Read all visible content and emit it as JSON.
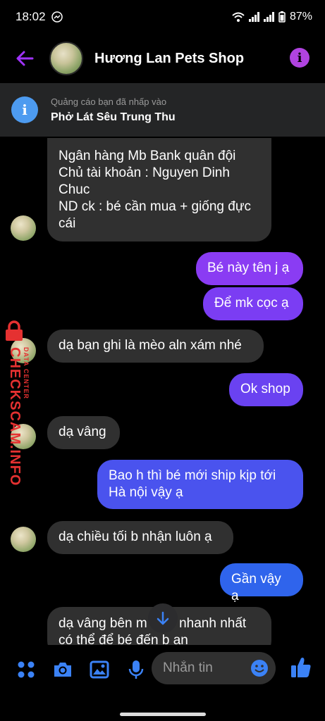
{
  "status": {
    "time": "18:02",
    "battery": "87%"
  },
  "header": {
    "title": "Hương Lan Pets Shop"
  },
  "ad": {
    "subtitle": "Quảng cáo bạn đã nhấp vào",
    "title": "Phở Lát Sêu Trung Thu"
  },
  "messages": [
    {
      "dir": "in",
      "text": "Ngân hàng Mb Bank quân đội\nChủ tài khoản : Nguyen Dinh Chuc\nND ck : bé cần mua + giống đực cái"
    },
    {
      "dir": "out",
      "text": "Bé này tên j ạ"
    },
    {
      "dir": "out",
      "text": "Để mk cọc ạ"
    },
    {
      "dir": "in",
      "text": "dạ bạn ghi là mèo aln xám nhé"
    },
    {
      "dir": "out",
      "text": "Ok shop"
    },
    {
      "dir": "in",
      "text": "dạ vâng"
    },
    {
      "dir": "out",
      "text": "Bao h thì bé mới ship kịp tới Hà nội vậy ạ"
    },
    {
      "dir": "in",
      "text": "dạ chiều tối b nhận luôn ạ"
    },
    {
      "dir": "out",
      "text": "Gần vậy ạ"
    },
    {
      "dir": "in",
      "text": "dạ vâng bên m ship nhanh nhất có thể để bé đến b an"
    }
  ],
  "composer": {
    "placeholder": "Nhắn tin"
  },
  "watermark": {
    "main": "CHECKSCAM.INFO",
    "sub": "DATA CENTER"
  },
  "colors": {
    "accent": "#a033ff",
    "blue": "#3b82f6",
    "incoming": "#303030"
  }
}
